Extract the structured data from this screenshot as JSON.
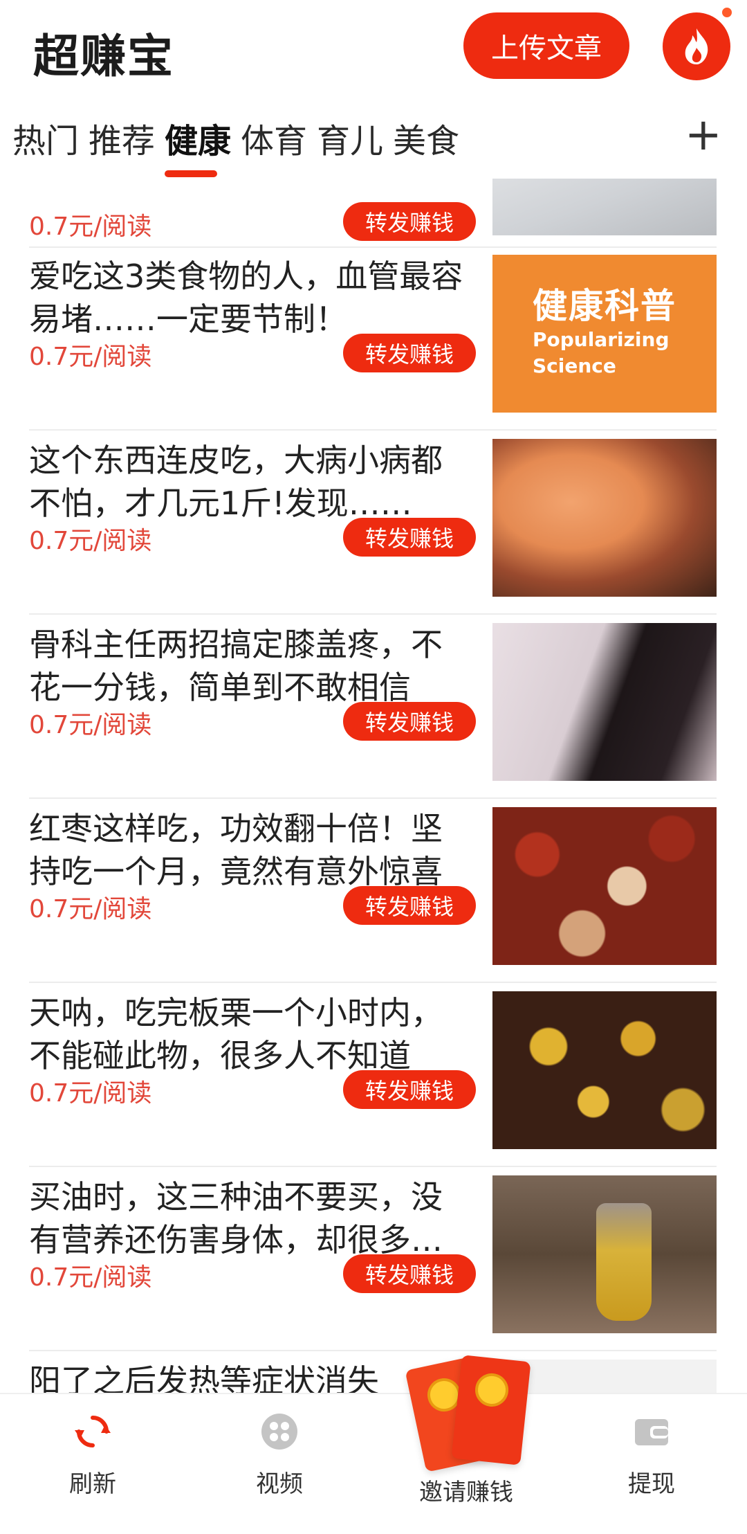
{
  "header": {
    "app_title": "超赚宝",
    "upload_label": "上传文章"
  },
  "tabs": [
    {
      "label": "热门"
    },
    {
      "label": "推荐"
    },
    {
      "label": "健康"
    },
    {
      "label": "体育"
    },
    {
      "label": "育儿"
    },
    {
      "label": "美食"
    }
  ],
  "active_tab": "健康",
  "tab_add": "+",
  "articles": [
    {
      "title": "",
      "price": "0.7元/阅读",
      "share": "转发赚钱",
      "thumb": "laptop"
    },
    {
      "title": "爱吃这3类食物的人，血管最容易堵……一定要节制！",
      "price": "0.7元/阅读",
      "share": "转发赚钱",
      "thumb": "health-science",
      "thumb_text_cn": "健康科普",
      "thumb_text_en_1": "Popularizing",
      "thumb_text_en_2": "Science"
    },
    {
      "title": "这个东西连皮吃，大病小病都不怕，才几元1斤!发现……",
      "price": "0.7元/阅读",
      "share": "转发赚钱",
      "thumb": "sweet-potato"
    },
    {
      "title": "骨科主任两招搞定膝盖疼，不花一分钱，简单到不敢相信",
      "price": "0.7元/阅读",
      "share": "转发赚钱",
      "thumb": "knee"
    },
    {
      "title": "红枣这样吃，功效翻十倍！坚持吃一个月，竟然有意外惊喜",
      "price": "0.7元/阅读",
      "share": "转发赚钱",
      "thumb": "red-dates"
    },
    {
      "title": "天呐，吃完板栗一个小时内，不能碰此物，很多人不知道",
      "price": "0.7元/阅读",
      "share": "转发赚钱",
      "thumb": "chestnuts"
    },
    {
      "title": "买油时，这三种油不要买，没有营养还伤害身体，却很多人买",
      "price": "0.7元/阅读",
      "share": "转发赚钱",
      "thumb": "oil"
    },
    {
      "title": "阳了之后发热等症状消失",
      "price": "",
      "share": "",
      "thumb": "person"
    }
  ],
  "bottom_nav": [
    {
      "label": "刷新",
      "icon": "refresh-icon",
      "active": true
    },
    {
      "label": "视频",
      "icon": "video-icon",
      "active": false
    },
    {
      "label": "邀请赚钱",
      "icon": "red-packet-icon",
      "active": false
    },
    {
      "label": "提现",
      "icon": "wallet-icon",
      "active": false
    }
  ],
  "colors": {
    "accent": "#ee2b10",
    "price": "#e2473a",
    "health_thumb": "#f08a30"
  }
}
